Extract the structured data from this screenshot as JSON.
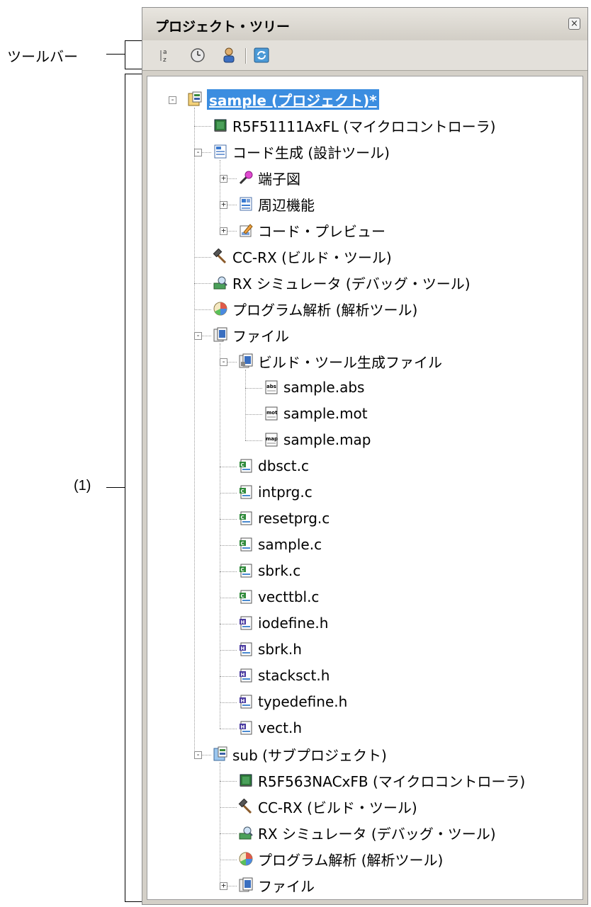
{
  "callouts": {
    "toolbar": "ツールバー",
    "tree": "(1)"
  },
  "panel": {
    "title": "プロジェクト・ツリー",
    "close_icon": "close-icon"
  },
  "toolbar": {
    "buttons": [
      "sort-icon",
      "clock-icon",
      "person-icon",
      "refresh-icon"
    ]
  },
  "tree": {
    "items": [
      {
        "label": "sample (プロジェクト)*",
        "icon": "project-icon",
        "depth": 0,
        "toggle": "minus",
        "selected": true
      },
      {
        "label": "R5F51111AxFL (マイクロコントローラ)",
        "icon": "chip-icon",
        "depth": 1
      },
      {
        "label": "コード生成 (設計ツール)",
        "icon": "codegen-icon",
        "depth": 1,
        "toggle": "minus"
      },
      {
        "label": "端子図",
        "icon": "pin-icon",
        "depth": 2,
        "toggle": "plus"
      },
      {
        "label": "周辺機能",
        "icon": "peripheral-icon",
        "depth": 2,
        "toggle": "plus"
      },
      {
        "label": "コード・プレビュー",
        "icon": "preview-icon",
        "depth": 2,
        "toggle": "plus"
      },
      {
        "label": "CC-RX (ビルド・ツール)",
        "icon": "hammer-icon",
        "depth": 1
      },
      {
        "label": "RX シミュレータ (デバッグ・ツール)",
        "icon": "debugger-icon",
        "depth": 1
      },
      {
        "label": "プログラム解析 (解析ツール)",
        "icon": "analysis-icon",
        "depth": 1
      },
      {
        "label": "ファイル",
        "icon": "folder-icon",
        "depth": 1,
        "toggle": "minus"
      },
      {
        "label": "ビルド・ツール生成ファイル",
        "icon": "build-folder-icon",
        "depth": 2,
        "toggle": "minus"
      },
      {
        "label": "sample.abs",
        "icon": "abs-file-icon",
        "depth": 3
      },
      {
        "label": "sample.mot",
        "icon": "mot-file-icon",
        "depth": 3
      },
      {
        "label": "sample.map",
        "icon": "map-file-icon",
        "depth": 3
      },
      {
        "label": "dbsct.c",
        "icon": "c-file-icon",
        "depth": 2
      },
      {
        "label": "intprg.c",
        "icon": "c-file-icon",
        "depth": 2
      },
      {
        "label": "resetprg.c",
        "icon": "c-file-icon",
        "depth": 2
      },
      {
        "label": "sample.c",
        "icon": "c-file-icon",
        "depth": 2
      },
      {
        "label": "sbrk.c",
        "icon": "c-file-icon",
        "depth": 2
      },
      {
        "label": "vecttbl.c",
        "icon": "c-file-icon",
        "depth": 2
      },
      {
        "label": "iodefine.h",
        "icon": "h-file-icon",
        "depth": 2
      },
      {
        "label": "sbrk.h",
        "icon": "h-file-icon",
        "depth": 2
      },
      {
        "label": "stacksct.h",
        "icon": "h-file-icon",
        "depth": 2
      },
      {
        "label": "typedefine.h",
        "icon": "h-file-icon",
        "depth": 2
      },
      {
        "label": "vect.h",
        "icon": "h-file-icon",
        "depth": 2
      },
      {
        "label": "sub (サブプロジェクト)",
        "icon": "subproject-icon",
        "depth": 1,
        "toggle": "minus"
      },
      {
        "label": "R5F563NACxFB (マイクロコントローラ)",
        "icon": "chip-icon",
        "depth": 2
      },
      {
        "label": "CC-RX (ビルド・ツール)",
        "icon": "hammer-icon",
        "depth": 2
      },
      {
        "label": "RX シミュレータ (デバッグ・ツール)",
        "icon": "debugger-icon",
        "depth": 2
      },
      {
        "label": "プログラム解析 (解析ツール)",
        "icon": "analysis-icon",
        "depth": 2
      },
      {
        "label": "ファイル",
        "icon": "folder-icon",
        "depth": 2,
        "toggle": "plus"
      }
    ]
  }
}
